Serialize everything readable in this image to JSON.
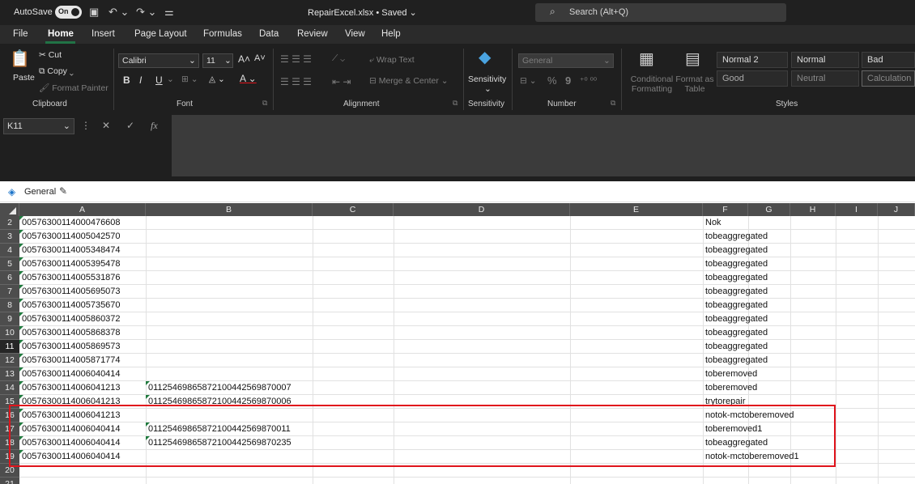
{
  "titlebar": {
    "autosave_label": "AutoSave",
    "autosave_state": "On",
    "doc_title": "RepairExcel.xlsx • Saved ⌄",
    "search_placeholder": "Search (Alt+Q)"
  },
  "tabs": [
    "File",
    "Home",
    "Insert",
    "Page Layout",
    "Formulas",
    "Data",
    "Review",
    "View",
    "Help"
  ],
  "ribbon": {
    "clipboard": {
      "paste": "Paste",
      "cut": "Cut",
      "copy": "Copy",
      "format_painter": "Format Painter",
      "label": "Clipboard"
    },
    "font": {
      "name": "Calibri",
      "size": "11",
      "bold": "B",
      "italic": "I",
      "underline": "U",
      "label": "Font"
    },
    "alignment": {
      "wrap": "Wrap Text",
      "merge": "Merge & Center",
      "label": "Alignment"
    },
    "sensitivity": {
      "button": "Sensitivity",
      "label": "Sensitivity"
    },
    "number": {
      "format": "General",
      "percent": "%",
      "comma": "9",
      "label": "Number"
    },
    "styles": {
      "conditional": "Conditional Formatting",
      "format_table": "Format as Table",
      "cells": [
        "Normal 2",
        "Normal",
        "Bad",
        "Good",
        "Neutral",
        "Calculation"
      ],
      "label": "Styles"
    }
  },
  "formula_bar": {
    "name_box": "K11",
    "fx": "fx",
    "value": ""
  },
  "sensitivity_bar": {
    "label": "General"
  },
  "columns": [
    "A",
    "B",
    "C",
    "D",
    "E",
    "F",
    "G",
    "H",
    "I",
    "J"
  ],
  "rows": [
    {
      "num": "2",
      "a": "00576300114000476608",
      "b": "",
      "f": "Nok"
    },
    {
      "num": "3",
      "a": "00576300114005042570",
      "b": "",
      "f": "tobeaggregated"
    },
    {
      "num": "4",
      "a": "00576300114005348474",
      "b": "",
      "f": "tobeaggregated"
    },
    {
      "num": "5",
      "a": "00576300114005395478",
      "b": "",
      "f": "tobeaggregated"
    },
    {
      "num": "6",
      "a": "00576300114005531876",
      "b": "",
      "f": "tobeaggregated"
    },
    {
      "num": "7",
      "a": "00576300114005695073",
      "b": "",
      "f": "tobeaggregated"
    },
    {
      "num": "8",
      "a": "00576300114005735670",
      "b": "",
      "f": "tobeaggregated"
    },
    {
      "num": "9",
      "a": "00576300114005860372",
      "b": "",
      "f": "tobeaggregated"
    },
    {
      "num": "10",
      "a": "00576300114005868378",
      "b": "",
      "f": "tobeaggregated"
    },
    {
      "num": "11",
      "a": "00576300114005869573",
      "b": "",
      "f": "tobeaggregated"
    },
    {
      "num": "12",
      "a": "00576300114005871774",
      "b": "",
      "f": "tobeaggregated"
    },
    {
      "num": "13",
      "a": "00576300114006040414",
      "b": "",
      "f": "toberemoved"
    },
    {
      "num": "14",
      "a": "00576300114006041213",
      "b": "0112546986587210044256987000​7",
      "f": "toberemoved"
    },
    {
      "num": "15",
      "a": "00576300114006041213",
      "b": "01125469865872100442569870006",
      "f": "trytorepair"
    },
    {
      "num": "16",
      "a": "00576300114006041213",
      "b": "",
      "f": "notok-mctoberemoved"
    },
    {
      "num": "17",
      "a": "00576300114006040414",
      "b": "01125469865872100442569870011",
      "f": "toberemoved1"
    },
    {
      "num": "18",
      "a": "00576300114006040414",
      "b": "01125469865872100442569870235",
      "f": "tobeaggregated"
    },
    {
      "num": "19",
      "a": "00576300114006040414",
      "b": "",
      "f": "notok-mctoberemoved1"
    },
    {
      "num": "20",
      "a": "",
      "b": "",
      "f": ""
    },
    {
      "num": "21",
      "a": "",
      "b": "",
      "f": ""
    }
  ]
}
